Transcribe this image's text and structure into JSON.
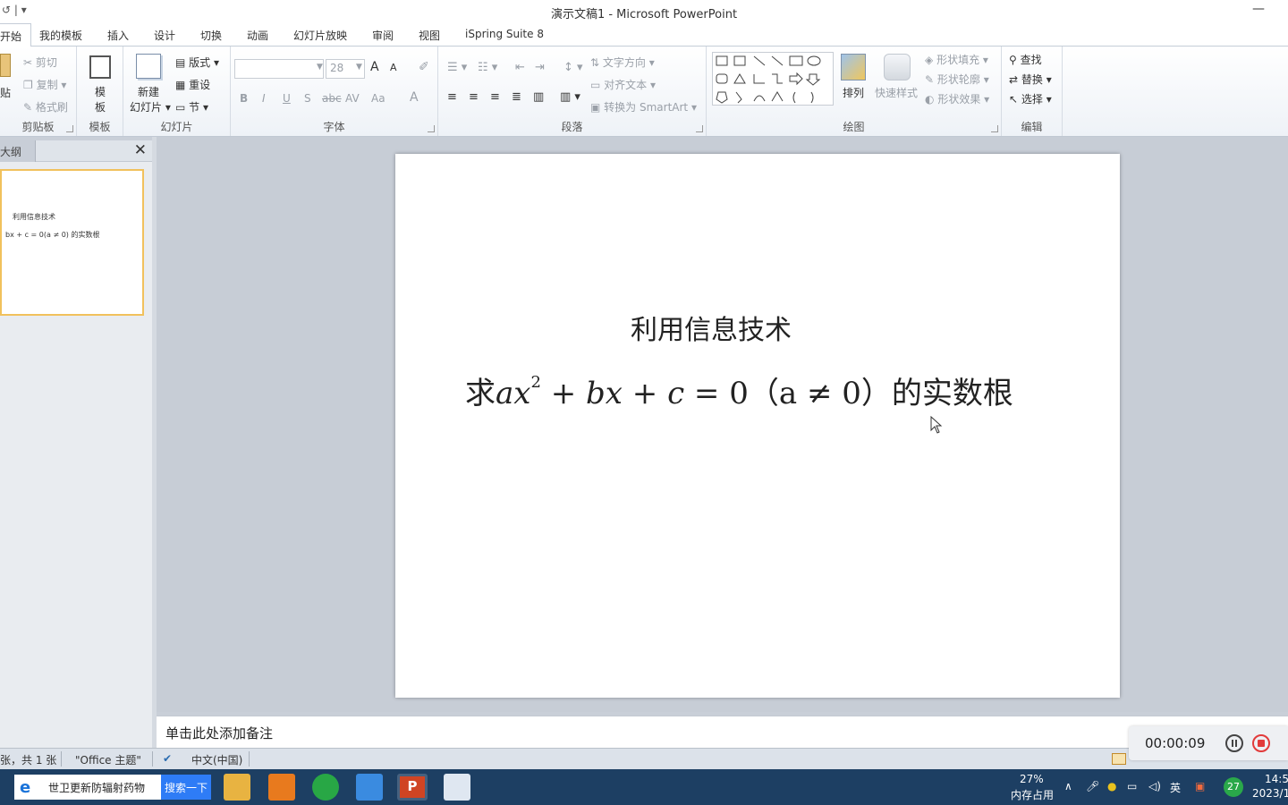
{
  "window": {
    "title": "演示文稿1 - Microsoft PowerPoint",
    "qa_icons": "↺ | ▾",
    "minimize": "—"
  },
  "tabs": [
    "开始",
    "我的模板",
    "插入",
    "设计",
    "切换",
    "动画",
    "幻灯片放映",
    "审阅",
    "视图",
    "iSpring Suite 8"
  ],
  "ribbon": {
    "clipboard": {
      "paste": "贴",
      "cut": "剪切",
      "copy": "复制",
      "format_painter": "格式刷",
      "name": "剪贴板"
    },
    "templates": {
      "template": "模",
      "template2": "板",
      "name": "模板"
    },
    "slides": {
      "new_slide": "新建",
      "new_slide2": "幻灯片",
      "layout": "版式",
      "reset": "重设",
      "section": "节",
      "name": "幻灯片"
    },
    "font": {
      "size": "28",
      "bold": "B",
      "italic": "I",
      "underline": "U",
      "shadow": "S",
      "strike": "abc",
      "spacing": "AV",
      "case": "Aa",
      "color": "A",
      "grow": "A",
      "shrink": "A",
      "name": "字体"
    },
    "paragraph": {
      "text_direction": "文字方向",
      "align_text": "对齐文本",
      "smartart": "转换为 SmartArt",
      "name": "段落"
    },
    "drawing": {
      "arrange": "排列",
      "quick_styles": "快速样式",
      "shape_fill": "形状填充",
      "shape_outline": "形状轮廓",
      "shape_effects": "形状效果",
      "name": "绘图"
    },
    "editing": {
      "find": "查找",
      "replace": "替换",
      "select": "选择",
      "name": "编辑"
    }
  },
  "outline_pane": {
    "tab": "大纲",
    "close": "✕",
    "thumb_line1": "利用信息技术",
    "thumb_line2": "bx + c = 0(a ≠ 0) 的实数根"
  },
  "slide": {
    "title": "利用信息技术",
    "eq_prefix": "求",
    "eq_a": "ax",
    "eq_exp": "2",
    "eq_plus1": " + ",
    "eq_b": "bx",
    "eq_plus2": " + ",
    "eq_c": "c",
    "eq_rest": " = 0（a ≠ 0）的实数根"
  },
  "notes": {
    "placeholder": "单击此处添加备注"
  },
  "status": {
    "slide_count": "张，共 1 张",
    "theme": "\"Office 主题\"",
    "language": "中文(中国)"
  },
  "recorder": {
    "time": "00:00:09"
  },
  "taskbar": {
    "search_text": "世卫更新防辐射药物",
    "search_button": "搜索一下",
    "mem_percent": "27%",
    "mem_label": "内存占用",
    "ime": "英",
    "badge": "27",
    "time": "14:5",
    "date": "2023/1"
  }
}
